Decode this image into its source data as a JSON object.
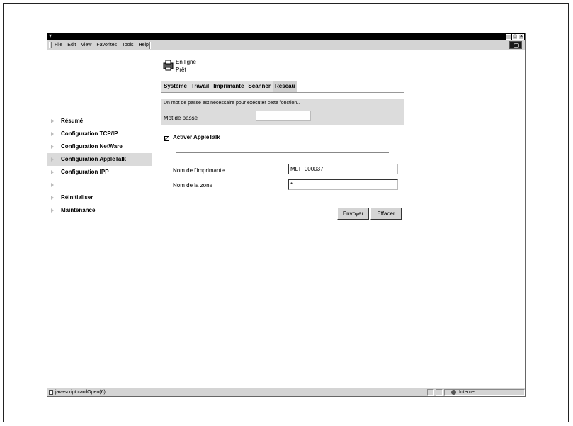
{
  "menu": {
    "items": [
      {
        "label": "File"
      },
      {
        "label": "Edit"
      },
      {
        "label": "View"
      },
      {
        "label": "Favorites"
      },
      {
        "label": "Tools"
      },
      {
        "label": "Help"
      }
    ]
  },
  "window_controls": {
    "minimize": "_",
    "maximize": "□",
    "close": "×"
  },
  "status": {
    "line1": "En ligne",
    "line2": "Prêt",
    "icon": "printer-icon"
  },
  "tabs": [
    {
      "label": "Système"
    },
    {
      "label": "Travail"
    },
    {
      "label": "Imprimante"
    },
    {
      "label": "Scanner"
    },
    {
      "label": "Réseau"
    }
  ],
  "sidebar": {
    "items": [
      {
        "label": "Résumé"
      },
      {
        "label": "Configuration TCP/IP"
      },
      {
        "label": "Configuration NetWare"
      },
      {
        "label": "Configuration AppleTalk",
        "active": true
      },
      {
        "label": "Configuration IPP"
      },
      {
        "label": ""
      },
      {
        "label": "Réinitialiser"
      },
      {
        "label": "Maintenance"
      }
    ]
  },
  "password": {
    "message": "Un mot de passe est nécessaire pour exécuter cette fonction..",
    "label": "Mot de passe",
    "value": ""
  },
  "appletalk": {
    "enable_label": "Activer AppleTalk",
    "enabled": true,
    "printer_name_label": "Nom de l'imprimante",
    "printer_name_value": "MLT_000037",
    "zone_label": "Nom de la zone",
    "zone_value": "*"
  },
  "buttons": {
    "send": "Envoyer",
    "clear": "Effacer"
  },
  "statusbar": {
    "message": "javascript:cardOpen(6)",
    "zone": "Internet"
  }
}
